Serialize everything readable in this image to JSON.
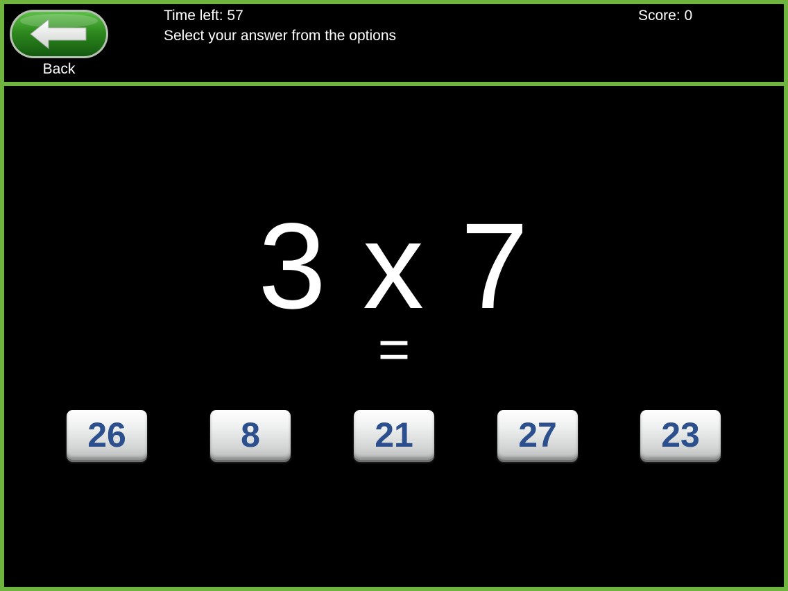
{
  "header": {
    "back_label": "Back",
    "time_left": "Time left: 57",
    "instructions": "Select your answer from the options",
    "score": "Score: 0"
  },
  "question": {
    "expression": "3 x 7",
    "equals": "="
  },
  "answers": [
    "26",
    "8",
    "21",
    "27",
    "23"
  ],
  "icons": {
    "back": "left-arrow-icon"
  },
  "colors": {
    "frame_green": "#6fb43f",
    "background": "#000000",
    "back_button_green": "#2e8a1e",
    "answer_text": "#2c4f8e",
    "text": "#ffffff"
  }
}
